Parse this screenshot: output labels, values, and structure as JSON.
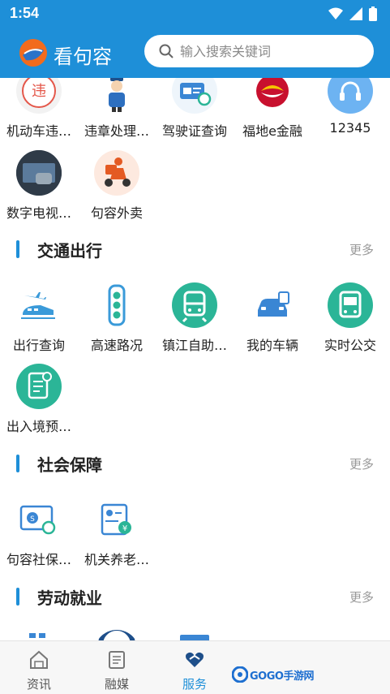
{
  "status_bar": {
    "time": "1:54"
  },
  "header": {
    "app_title": "看句容",
    "search_placeholder": "输入搜索关键词"
  },
  "top_grid": {
    "items": [
      {
        "label": "机动车违…",
        "icon": "traffic-violation-icon"
      },
      {
        "label": "违章处理…",
        "icon": "traffic-police-icon"
      },
      {
        "label": "驾驶证查询",
        "icon": "driver-license-icon"
      },
      {
        "label": "福地e金融",
        "icon": "bank-logo-icon"
      },
      {
        "label": "12345",
        "icon": "hotline-headset-icon"
      },
      {
        "label": "数字电视…",
        "icon": "digital-tv-icon"
      },
      {
        "label": "句容外卖",
        "icon": "delivery-scooter-icon"
      }
    ]
  },
  "sections": [
    {
      "title": "交通出行",
      "more": "更多",
      "items": [
        {
          "label": "出行查询",
          "icon": "train-plane-icon"
        },
        {
          "label": "高速路况",
          "icon": "traffic-light-icon"
        },
        {
          "label": "镇江自助…",
          "icon": "bus-teal-icon"
        },
        {
          "label": "我的车辆",
          "icon": "car-document-icon"
        },
        {
          "label": "实时公交",
          "icon": "bus-realtime-icon"
        },
        {
          "label": "出入境预…",
          "icon": "passport-document-icon"
        }
      ]
    },
    {
      "title": "社会保障",
      "more": "更多",
      "items": [
        {
          "label": "句容社保…",
          "icon": "social-security-card-icon"
        },
        {
          "label": "机关养老…",
          "icon": "pension-card-icon"
        }
      ]
    },
    {
      "title": "劳动就业",
      "more": "更多",
      "items": []
    }
  ],
  "tab_bar": {
    "tabs": [
      {
        "label": "资讯",
        "icon": "home-icon",
        "active": false
      },
      {
        "label": "融媒",
        "icon": "media-document-icon",
        "active": false
      },
      {
        "label": "服务",
        "icon": "heart-service-icon",
        "active": true
      }
    ]
  },
  "watermark": {
    "text": "GOGO手游网"
  },
  "colors": {
    "primary": "#1e8fd8",
    "teal": "#2bb597"
  }
}
